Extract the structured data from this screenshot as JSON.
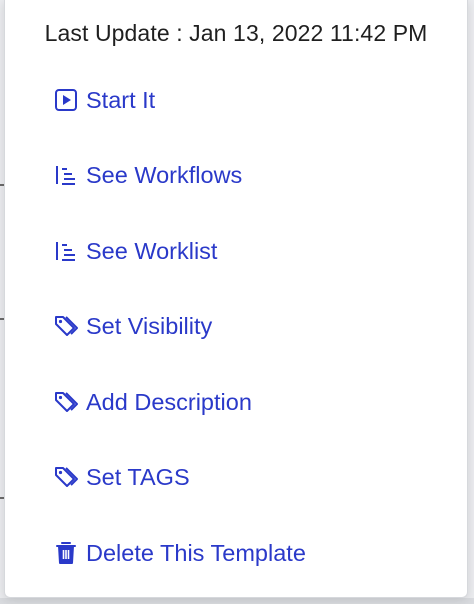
{
  "header": {
    "last_update": "Last Update : Jan 13, 2022 11:42 PM"
  },
  "colors": {
    "accent": "#2a39c9",
    "header_text": "#1f1f1f",
    "menu_bg": "#ffffff"
  },
  "menu": {
    "items": [
      {
        "label": "Start It",
        "icon": "play-square-icon"
      },
      {
        "label": "See Workflows",
        "icon": "tree-list-icon"
      },
      {
        "label": "See Worklist",
        "icon": "tree-list-icon"
      },
      {
        "label": "Set Visibility",
        "icon": "tag-icon"
      },
      {
        "label": "Add Description",
        "icon": "tag-icon"
      },
      {
        "label": "Set TAGS",
        "icon": "tag-icon"
      },
      {
        "label": "Delete This Template",
        "icon": "trash-icon"
      }
    ]
  }
}
